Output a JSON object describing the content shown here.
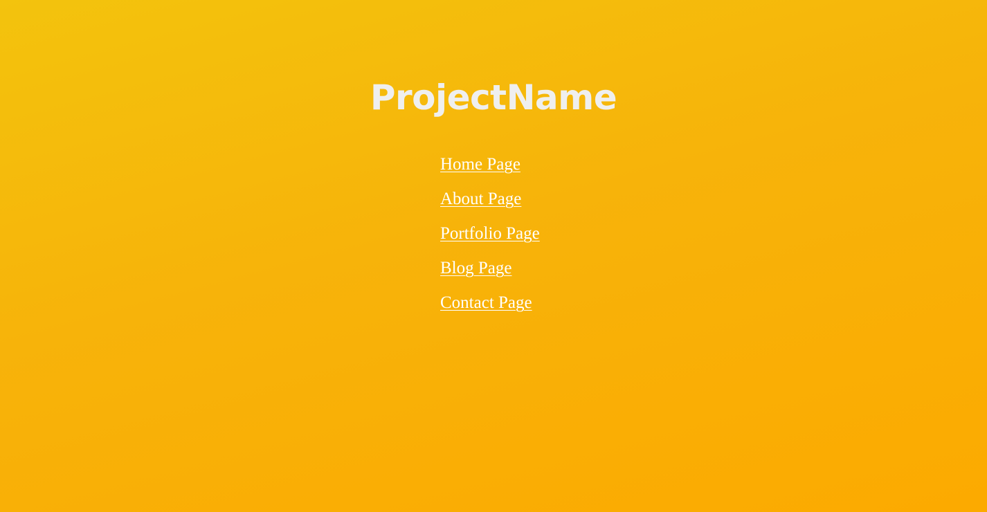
{
  "header": {
    "title": "ProjectName"
  },
  "nav": {
    "items": [
      {
        "label": "Home Page"
      },
      {
        "label": "About Page"
      },
      {
        "label": "Portfolio Page"
      },
      {
        "label": "Blog Page"
      },
      {
        "label": "Contact Page"
      }
    ]
  },
  "colors": {
    "background_top": "#f3c30d",
    "background_bottom": "#fcaa00",
    "title_text": "#efefef",
    "link_text": "#ffffff"
  }
}
